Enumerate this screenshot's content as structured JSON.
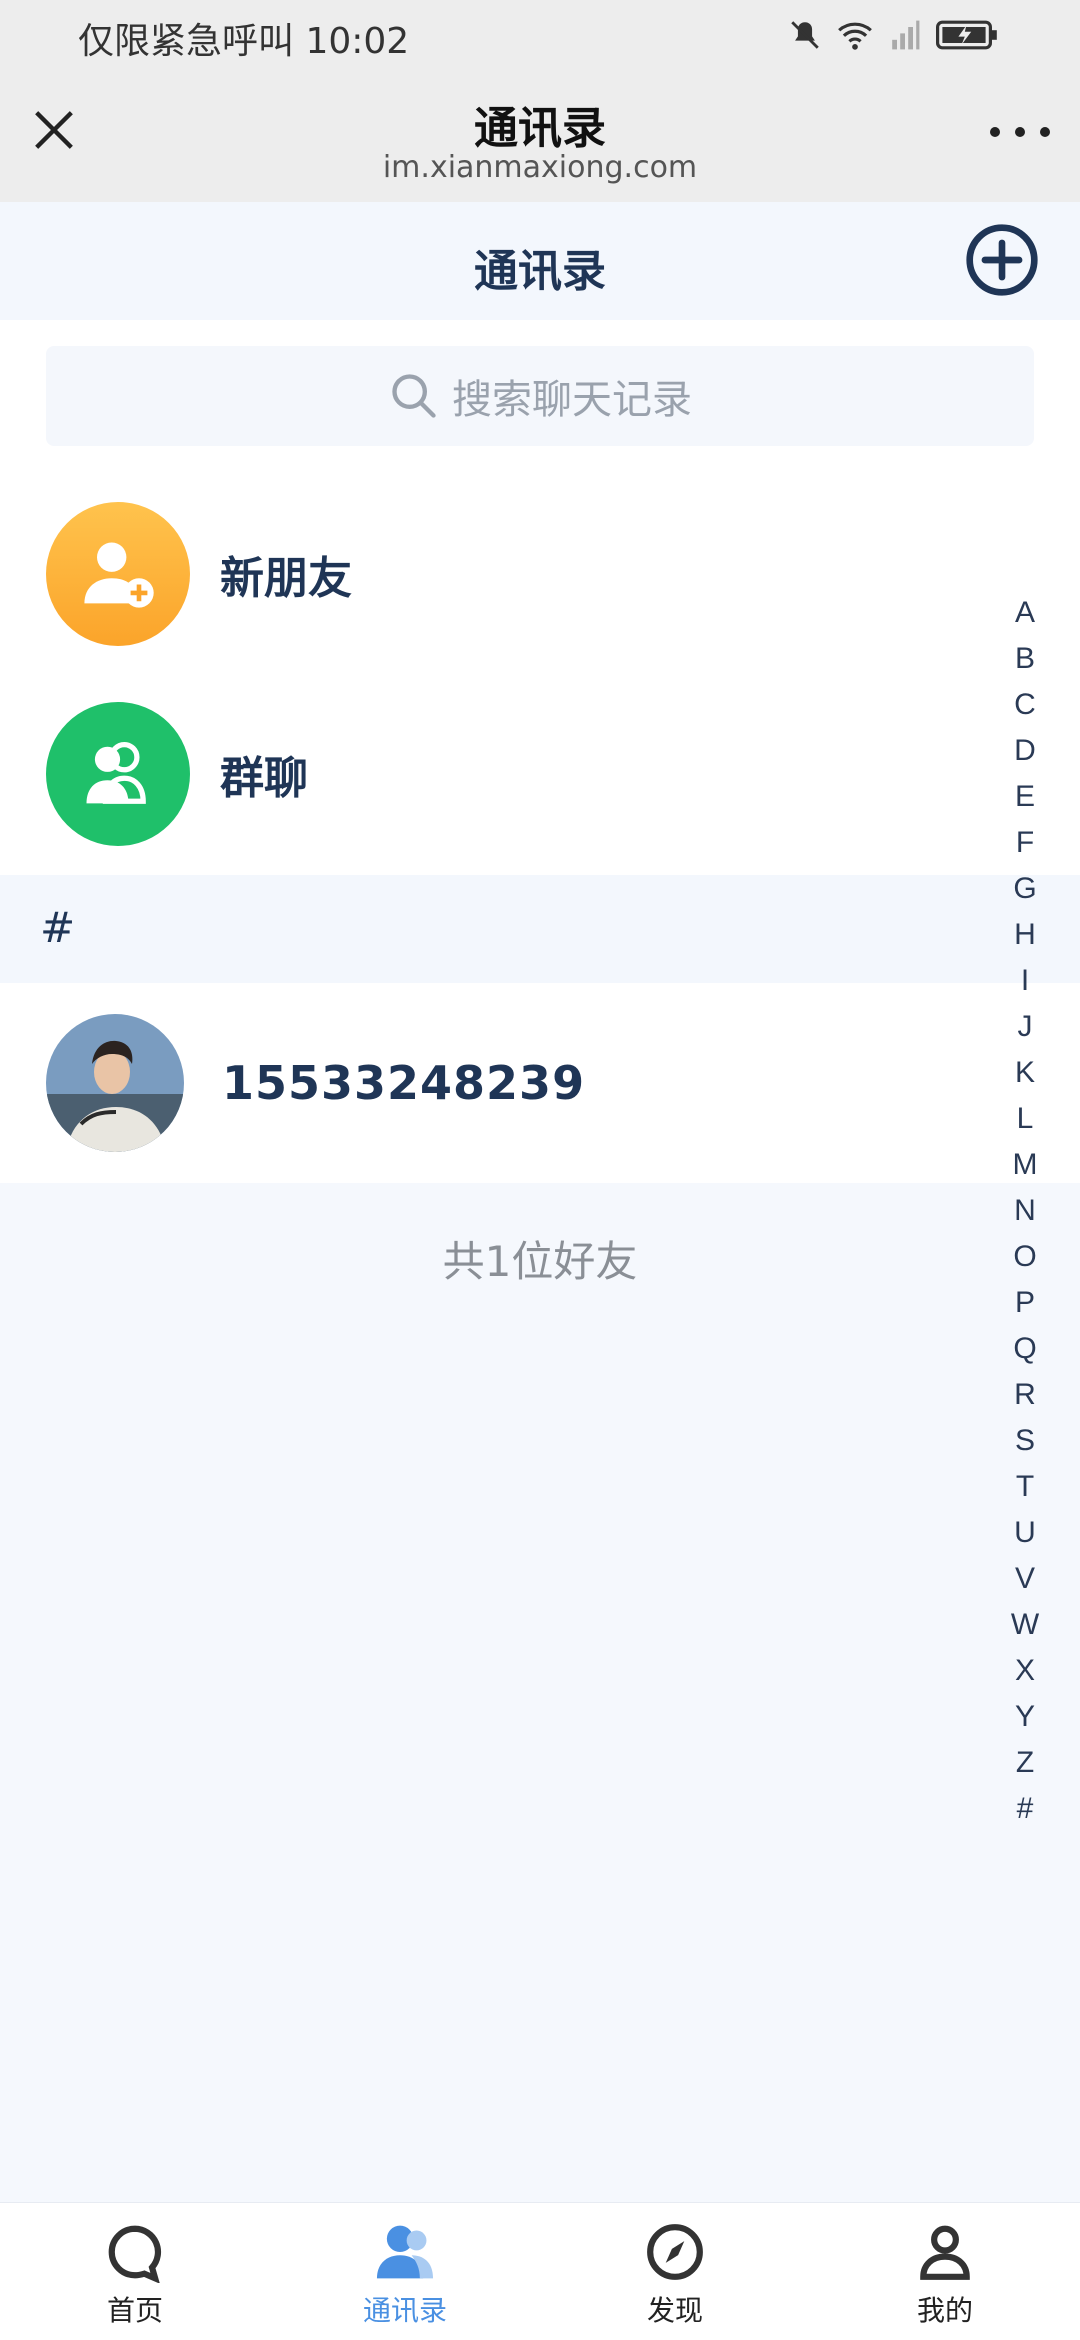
{
  "status_bar": {
    "text": "仅限紧急呼叫 10:02"
  },
  "web_header": {
    "title": "通讯录",
    "url": "im.xianmaxiong.com"
  },
  "page": {
    "title": "通讯录"
  },
  "search": {
    "placeholder": "搜索聊天记录"
  },
  "special_entries": [
    {
      "label": "新朋友",
      "icon": "add-user-icon",
      "color": "#fdb13a"
    },
    {
      "label": "群聊",
      "icon": "group-icon",
      "color": "#1fc06a"
    }
  ],
  "section_header": "#",
  "contacts": [
    {
      "name": "15533248239"
    }
  ],
  "friend_count_text": "共1位好友",
  "index_letters": [
    "A",
    "B",
    "C",
    "D",
    "E",
    "F",
    "G",
    "H",
    "I",
    "J",
    "K",
    "L",
    "M",
    "N",
    "O",
    "P",
    "Q",
    "R",
    "S",
    "T",
    "U",
    "V",
    "W",
    "X",
    "Y",
    "Z",
    "#"
  ],
  "tabs": [
    {
      "label": "首页",
      "icon": "chat-bubble-icon",
      "active": false
    },
    {
      "label": "通讯录",
      "icon": "contacts-icon",
      "active": true
    },
    {
      "label": "发现",
      "icon": "compass-icon",
      "active": false
    },
    {
      "label": "我的",
      "icon": "profile-icon",
      "active": false
    }
  ],
  "colors": {
    "accent": "#4a90e2",
    "title_text": "#1f3556"
  }
}
